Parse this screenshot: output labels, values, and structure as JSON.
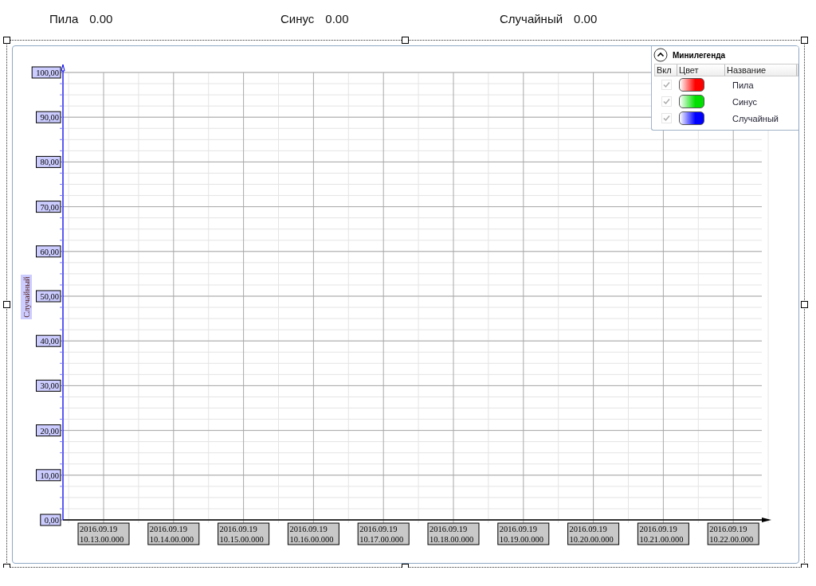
{
  "indicators": [
    {
      "label": "Пила",
      "value": "0.00"
    },
    {
      "label": "Синус",
      "value": "0.00"
    },
    {
      "label": "Случайный",
      "value": "0.00"
    }
  ],
  "chart": {
    "y_axis": {
      "title": "Случайный",
      "tick_labels": [
        "100,00",
        "90,00",
        "80,00",
        "70,00",
        "60,00",
        "50,00",
        "40,00",
        "30,00",
        "20,00",
        "10,00",
        "0,00"
      ]
    },
    "x_axis": {
      "tick_labels": [
        {
          "date": "2016.09.19",
          "time": "10.13.00.000"
        },
        {
          "date": "2016.09.19",
          "time": "10.14.00.000"
        },
        {
          "date": "2016.09.19",
          "time": "10.15.00.000"
        },
        {
          "date": "2016.09.19",
          "time": "10.16.00.000"
        },
        {
          "date": "2016.09.19",
          "time": "10.17.00.000"
        },
        {
          "date": "2016.09.19",
          "time": "10.18.00.000"
        },
        {
          "date": "2016.09.19",
          "time": "10.19.00.000"
        },
        {
          "date": "2016.09.19",
          "time": "10.20.00.000"
        },
        {
          "date": "2016.09.19",
          "time": "10.21.00.000"
        },
        {
          "date": "2016.09.19",
          "time": "10.22.00.000"
        }
      ]
    }
  },
  "legend": {
    "title": "Минилегенда",
    "columns": [
      "Вкл",
      "Цвет",
      "Название"
    ],
    "items": [
      {
        "name": "Пила",
        "color": "#ff0000",
        "checked": true,
        "disabled": true
      },
      {
        "name": "Синус",
        "color": "#00e000",
        "checked": true,
        "disabled": true
      },
      {
        "name": "Случайный",
        "color": "#0000ff",
        "checked": true,
        "disabled": true
      }
    ]
  }
}
